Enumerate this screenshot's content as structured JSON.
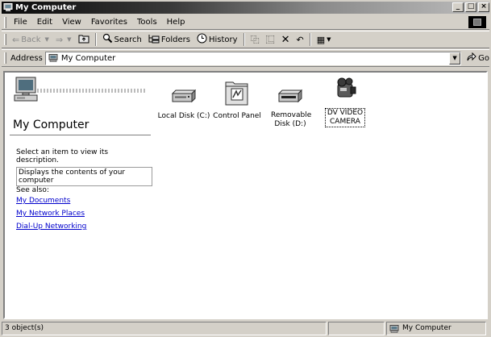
{
  "window": {
    "title": "My Computer"
  },
  "menu": {
    "items": [
      {
        "label": "File"
      },
      {
        "label": "Edit"
      },
      {
        "label": "View"
      },
      {
        "label": "Favorites"
      },
      {
        "label": "Tools"
      },
      {
        "label": "Help"
      }
    ]
  },
  "toolbar": {
    "back": "Back",
    "search": "Search",
    "folders": "Folders",
    "history": "History"
  },
  "address": {
    "label": "Address",
    "value": "My Computer",
    "go": "Go"
  },
  "webview": {
    "title": "My Computer",
    "description": "Select an item to view its description.",
    "tooltip": "Displays the contents of your computer",
    "see_also": "See also:",
    "links": [
      "My Documents",
      "My Network Places",
      "Dial-Up Networking"
    ]
  },
  "icons": [
    {
      "label": "Local Disk (C:)",
      "icon": "hard-disk-icon"
    },
    {
      "label": "Control Panel",
      "icon": "control-panel-icon"
    },
    {
      "label": "Removable Disk (D:)",
      "icon": "removable-disk-icon"
    },
    {
      "label": "DV VIDEO CAMERA",
      "icon": "video-camera-icon"
    }
  ],
  "status": {
    "objects": "3 object(s)",
    "zone": "My Computer"
  }
}
